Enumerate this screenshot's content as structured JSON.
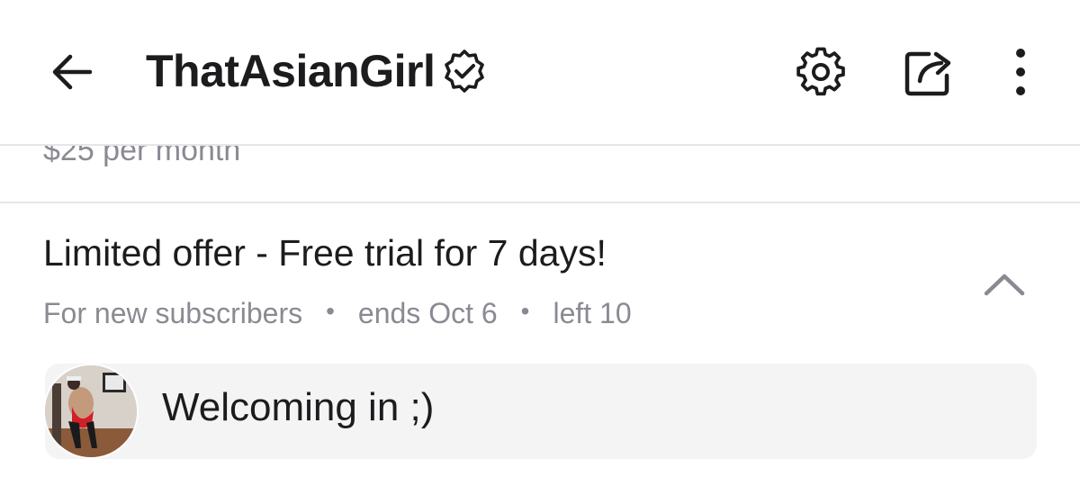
{
  "header": {
    "title": "ThatAsianGirl",
    "verified": true,
    "icons": [
      "back-arrow-icon",
      "verified-badge-icon",
      "gear-icon",
      "share-icon",
      "more-vertical-icon"
    ]
  },
  "subscription": {
    "price_text": "$25 per month"
  },
  "offer": {
    "title": "Limited offer - Free trial for 7 days!",
    "audience": "For new subscribers",
    "ends": "ends Oct 6",
    "left": "left 10",
    "separator": "•"
  },
  "message": {
    "text": "Welcoming in ;)"
  },
  "colors": {
    "text": "#1c1c1e",
    "muted": "#8a8a93",
    "divider": "#e6e6e9",
    "card": "#f4f4f5"
  }
}
